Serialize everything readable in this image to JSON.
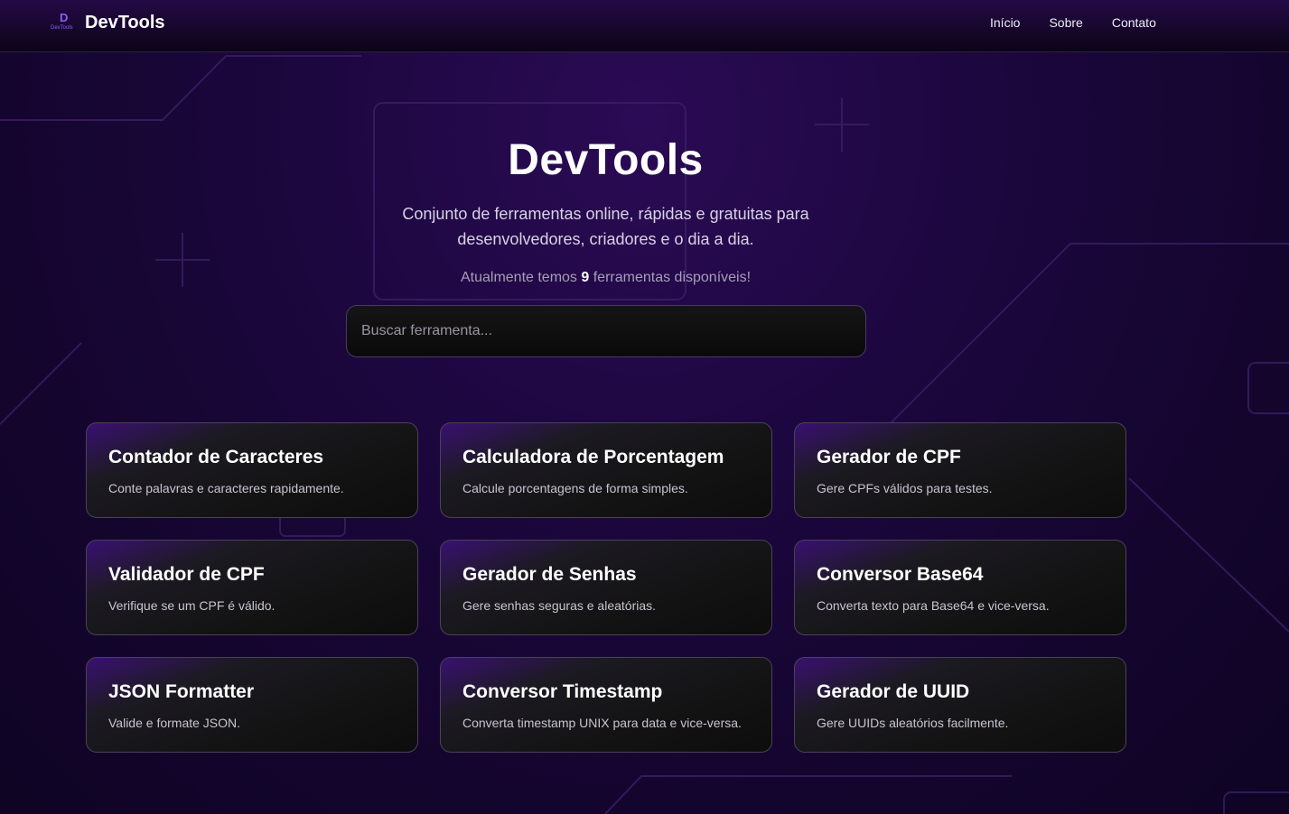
{
  "header": {
    "logo_letter": "D",
    "logo_small": "DevTools",
    "brand": "DevTools",
    "nav": [
      "Início",
      "Sobre",
      "Contato"
    ]
  },
  "hero": {
    "title": "DevTools",
    "subtitle": "Conjunto de ferramentas online, rápidas e gratuitas para desenvolvedores, criadores e o dia a dia.",
    "count_prefix": "Atualmente temos ",
    "count_value": "9",
    "count_suffix": " ferramentas disponíveis!"
  },
  "search": {
    "placeholder": "Buscar ferramenta...",
    "value": ""
  },
  "tools": [
    {
      "title": "Contador de Caracteres",
      "description": "Conte palavras e caracteres rapidamente."
    },
    {
      "title": "Calculadora de Porcentagem",
      "description": "Calcule porcentagens de forma simples."
    },
    {
      "title": "Gerador de CPF",
      "description": "Gere CPFs válidos para testes."
    },
    {
      "title": "Validador de CPF",
      "description": "Verifique se um CPF é válido."
    },
    {
      "title": "Gerador de Senhas",
      "description": "Gere senhas seguras e aleatórias."
    },
    {
      "title": "Conversor Base64",
      "description": "Converta texto para Base64 e vice-versa."
    },
    {
      "title": "JSON Formatter",
      "description": "Valide e formate JSON."
    },
    {
      "title": "Conversor Timestamp",
      "description": "Converta timestamp UNIX para data e vice-versa."
    },
    {
      "title": "Gerador de UUID",
      "description": "Gere UUIDs aleatórios facilmente."
    }
  ],
  "colors": {
    "accent": "#8f5bff",
    "background": "#1d0740",
    "card_border": "#4a4356"
  }
}
